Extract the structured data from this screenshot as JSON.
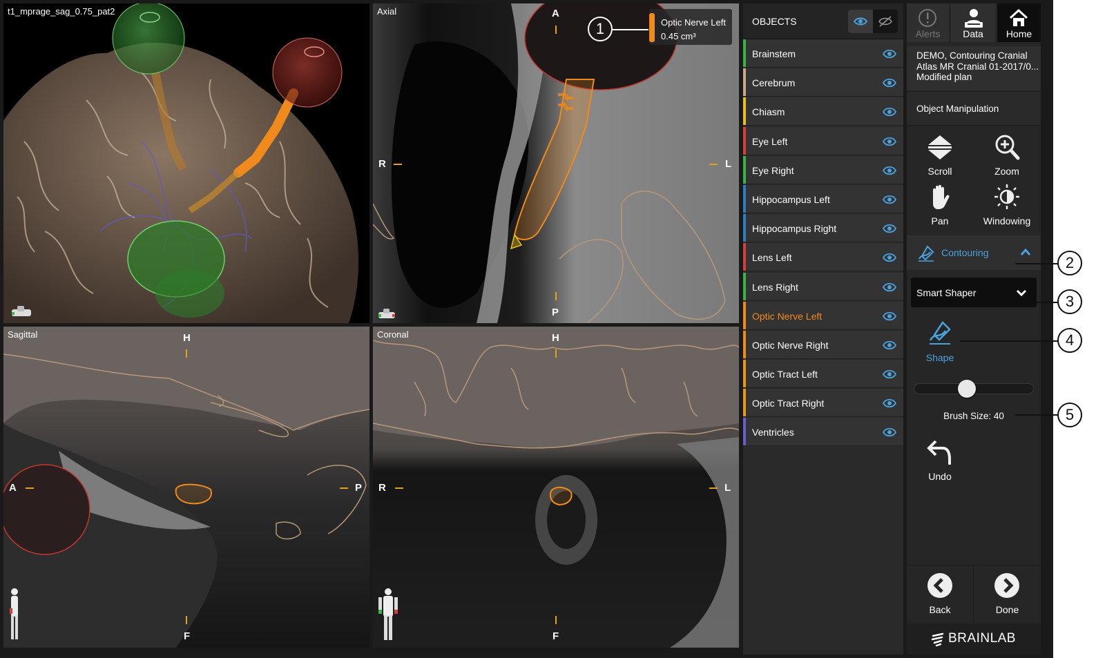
{
  "viewports": {
    "threed": {
      "title": "t1_mprage_sag_0.75_pat2"
    },
    "axial": {
      "title": "Axial",
      "orient": {
        "top": "A",
        "bottom": "P",
        "left": "R",
        "right": "L"
      },
      "annotation": {
        "name": "Optic Nerve Left",
        "volume": "0.45 cm³"
      }
    },
    "sagittal": {
      "title": "Sagittal",
      "orient": {
        "top": "H",
        "bottom": "F",
        "left": "A",
        "right": "P"
      }
    },
    "coronal": {
      "title": "Coronal",
      "orient": {
        "top": "H",
        "bottom": "F",
        "left": "R",
        "right": "L"
      }
    }
  },
  "callouts": [
    "1",
    "2",
    "3",
    "4",
    "5"
  ],
  "objects": {
    "title": "OBJECTS",
    "items": [
      {
        "label": "Brainstem",
        "color": "#3cb34a"
      },
      {
        "label": "Cerebrum",
        "color": "#c8a88e"
      },
      {
        "label": "Chiasm",
        "color": "#e8c21a"
      },
      {
        "label": "Eye Left",
        "color": "#d6403a"
      },
      {
        "label": "Eye Right",
        "color": "#3cb34a"
      },
      {
        "label": "Hippocampus Left",
        "color": "#2f7fc0"
      },
      {
        "label": "Hippocampus Right",
        "color": "#2f7fc0"
      },
      {
        "label": "Lens Left",
        "color": "#d6403a"
      },
      {
        "label": "Lens Right",
        "color": "#3cb34a"
      },
      {
        "label": "Optic Nerve Left",
        "color": "#f08a1c",
        "active": true
      },
      {
        "label": "Optic Nerve Right",
        "color": "#f08a1c"
      },
      {
        "label": "Optic Tract Left",
        "color": "#e39a1a"
      },
      {
        "label": "Optic Tract Right",
        "color": "#e39a1a"
      },
      {
        "label": "Ventricles",
        "color": "#6a5fc8"
      }
    ]
  },
  "topbar": {
    "alerts": "Alerts",
    "data": "Data",
    "home": "Home"
  },
  "plan": {
    "line1": "DEMO, Contouring Cranial",
    "line2": "Atlas MR Cranial 01-2017/0...",
    "line3": "Modified plan"
  },
  "mode": "Object Manipulation",
  "tools": {
    "scroll": "Scroll",
    "zoom": "Zoom",
    "pan": "Pan",
    "windowing": "Windowing"
  },
  "contouring": {
    "label": "Contouring"
  },
  "shaper": {
    "selected": "Smart Shaper"
  },
  "shape": {
    "label": "Shape"
  },
  "brush": {
    "label": "Brush Size: 40",
    "value": 40,
    "fraction": 0.44
  },
  "undo": {
    "label": "Undo"
  },
  "nav": {
    "back": "Back",
    "done": "Done"
  },
  "brand": "BRAINLAB",
  "colors": {
    "accent": "#4aa3df",
    "active_object": "#f08a1c",
    "orient_tick": "#e3a21a"
  }
}
